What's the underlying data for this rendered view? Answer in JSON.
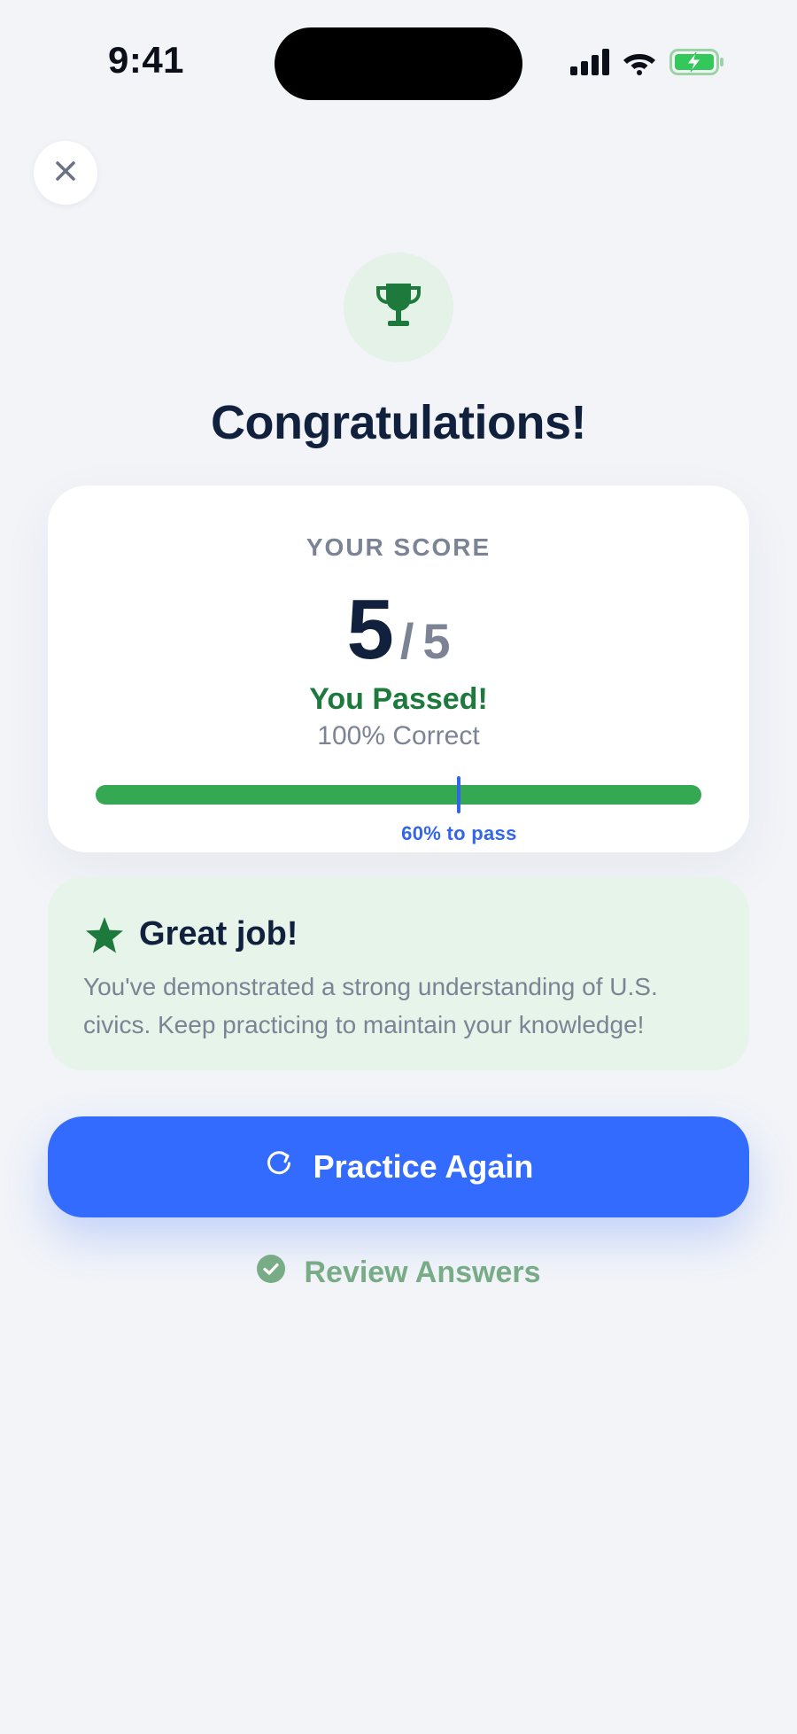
{
  "status_bar": {
    "time": "9:41",
    "icons": [
      "cellular-signal-icon",
      "wifi-icon",
      "battery-charging-icon"
    ]
  },
  "header": {
    "close_icon": "close-icon"
  },
  "hero": {
    "icon": "trophy-icon",
    "title": "Congratulations!"
  },
  "score_card": {
    "label": "YOUR SCORE",
    "score": "5",
    "separator": "/",
    "total": "5",
    "status": "You Passed!",
    "percent_text": "100% Correct",
    "progress_fraction": 1.0,
    "pass_threshold_fraction": 0.6,
    "pass_label": "60% to pass"
  },
  "feedback": {
    "icon": "star-icon",
    "title": "Great job!",
    "message": "You've demonstrated a strong understanding of U.S. civics. Keep practicing to maintain your knowledge!"
  },
  "actions": {
    "practice_label": "Practice Again",
    "practice_icon": "refresh-icon",
    "review_label": "Review Answers",
    "review_icon": "check-circle-icon"
  },
  "colors": {
    "accent_blue": "#336bff",
    "success_green": "#34a853",
    "dark_green": "#1e7a3c",
    "title_navy": "#11213d",
    "muted_gray": "#7b8394",
    "background": "#f2f4f8"
  }
}
